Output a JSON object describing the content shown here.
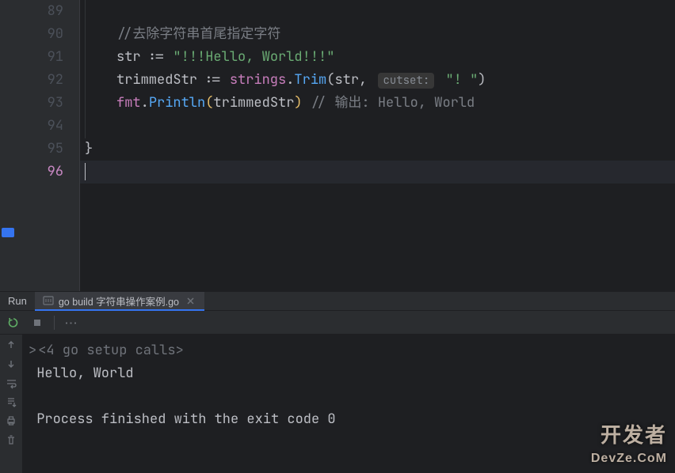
{
  "gutter": {
    "start": 89,
    "end": 96,
    "active": 96
  },
  "code": {
    "line89": "",
    "line90_comment": "//去除字符串首尾指定字符",
    "line91_ident": "str",
    "line91_assign": ":=",
    "line91_string": "\"!!!Hello, World!!!\"",
    "line92_ident": "trimmedStr",
    "line92_assign": ":=",
    "line92_pkg": "strings",
    "line92_dot": ".",
    "line92_func": "Trim",
    "line92_arg1": "str",
    "line92_comma": ",",
    "line92_hint": "cutset:",
    "line92_arg2": "\"! \"",
    "line93_pkg": "fmt",
    "line93_dot": ".",
    "line93_func": "Println",
    "line93_arg": "trimmedStr",
    "line93_comment_prefix": "// ",
    "line93_comment_text1": "输出: ",
    "line93_comment_text2": "Hello, World",
    "line95_brace": "}"
  },
  "tabs": {
    "run_label": "Run",
    "active_tab": "go build 字符串操作案例.go"
  },
  "console": {
    "fold_prefix": ">",
    "fold_text": "<4 go setup calls>",
    "output1": "Hello, World",
    "blank": "",
    "exit_msg": "Process finished with the exit code 0"
  },
  "watermark": {
    "line1": "开发者",
    "line2": "DevZe.CoM"
  },
  "icons": {
    "rerun": "rerun-icon",
    "stop": "stop-icon",
    "more": "more-icon",
    "up": "up-arrow-icon",
    "down": "down-arrow-icon",
    "wrap": "soft-wrap-icon",
    "scroll": "scroll-to-end-icon",
    "print": "print-icon",
    "trash": "trash-icon"
  }
}
